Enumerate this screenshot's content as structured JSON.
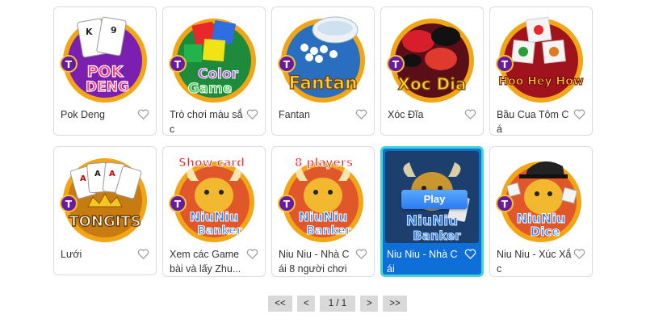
{
  "games": [
    {
      "title": "Pok Deng",
      "logo": "POK DENG",
      "art": "cards-k9"
    },
    {
      "title": "Trò chơi màu sắc",
      "logo": "Color Game",
      "art": "color-cubes"
    },
    {
      "title": "Fantan",
      "logo": "Fantan",
      "art": "porcelain-bowl"
    },
    {
      "title": "Xóc Đĩa",
      "logo": "Xoc Dia",
      "art": "red-black-discs"
    },
    {
      "title": "Bầu Cua Tôm Cá",
      "logo": "Hoo Hey How",
      "art": "dice-animals"
    },
    {
      "title": "Lưới",
      "logo": "TONGITS",
      "art": "cards-crown"
    },
    {
      "title": "Xem các Game bài và lấy Zhu...",
      "logo": "NiuNiu Banker",
      "banner": "Show card",
      "art": "bull"
    },
    {
      "title": "Niu Niu - Nhà Cái 8 người chơi",
      "logo": "NiuNiu Banker",
      "banner": "8 players",
      "art": "bull"
    },
    {
      "title": "Niu Niu - Nhà Cái",
      "logo": "NiuNiu Banker",
      "art": "bull",
      "play_label": "Play"
    },
    {
      "title": "Niu Niu - Xúc Xắc",
      "logo": "NiuNiu Dice",
      "art": "bull-hat"
    }
  ],
  "pagination": {
    "first": "<<",
    "prev": "<",
    "current": "1 / 1",
    "next": ">",
    "last": ">>"
  },
  "colors": {
    "active_card_bg": "#0f6fd9",
    "active_card_border": "#3fd7d1",
    "pager_bg": "#d9d9d9",
    "brand_badge": "#7b2fb8"
  },
  "icons": {
    "favorite": "heart-outline-icon",
    "brand": "t-badge-icon"
  }
}
